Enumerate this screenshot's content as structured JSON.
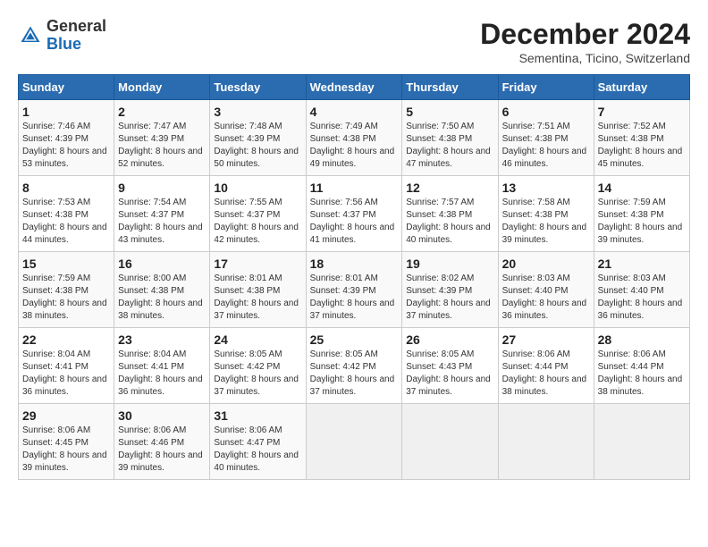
{
  "header": {
    "logo_line1": "General",
    "logo_line2": "Blue",
    "month_title": "December 2024",
    "subtitle": "Sementina, Ticino, Switzerland"
  },
  "weekdays": [
    "Sunday",
    "Monday",
    "Tuesday",
    "Wednesday",
    "Thursday",
    "Friday",
    "Saturday"
  ],
  "weeks": [
    [
      {
        "day": "1",
        "sunrise": "Sunrise: 7:46 AM",
        "sunset": "Sunset: 4:39 PM",
        "daylight": "Daylight: 8 hours and 53 minutes."
      },
      {
        "day": "2",
        "sunrise": "Sunrise: 7:47 AM",
        "sunset": "Sunset: 4:39 PM",
        "daylight": "Daylight: 8 hours and 52 minutes."
      },
      {
        "day": "3",
        "sunrise": "Sunrise: 7:48 AM",
        "sunset": "Sunset: 4:39 PM",
        "daylight": "Daylight: 8 hours and 50 minutes."
      },
      {
        "day": "4",
        "sunrise": "Sunrise: 7:49 AM",
        "sunset": "Sunset: 4:38 PM",
        "daylight": "Daylight: 8 hours and 49 minutes."
      },
      {
        "day": "5",
        "sunrise": "Sunrise: 7:50 AM",
        "sunset": "Sunset: 4:38 PM",
        "daylight": "Daylight: 8 hours and 47 minutes."
      },
      {
        "day": "6",
        "sunrise": "Sunrise: 7:51 AM",
        "sunset": "Sunset: 4:38 PM",
        "daylight": "Daylight: 8 hours and 46 minutes."
      },
      {
        "day": "7",
        "sunrise": "Sunrise: 7:52 AM",
        "sunset": "Sunset: 4:38 PM",
        "daylight": "Daylight: 8 hours and 45 minutes."
      }
    ],
    [
      {
        "day": "8",
        "sunrise": "Sunrise: 7:53 AM",
        "sunset": "Sunset: 4:38 PM",
        "daylight": "Daylight: 8 hours and 44 minutes."
      },
      {
        "day": "9",
        "sunrise": "Sunrise: 7:54 AM",
        "sunset": "Sunset: 4:37 PM",
        "daylight": "Daylight: 8 hours and 43 minutes."
      },
      {
        "day": "10",
        "sunrise": "Sunrise: 7:55 AM",
        "sunset": "Sunset: 4:37 PM",
        "daylight": "Daylight: 8 hours and 42 minutes."
      },
      {
        "day": "11",
        "sunrise": "Sunrise: 7:56 AM",
        "sunset": "Sunset: 4:37 PM",
        "daylight": "Daylight: 8 hours and 41 minutes."
      },
      {
        "day": "12",
        "sunrise": "Sunrise: 7:57 AM",
        "sunset": "Sunset: 4:38 PM",
        "daylight": "Daylight: 8 hours and 40 minutes."
      },
      {
        "day": "13",
        "sunrise": "Sunrise: 7:58 AM",
        "sunset": "Sunset: 4:38 PM",
        "daylight": "Daylight: 8 hours and 39 minutes."
      },
      {
        "day": "14",
        "sunrise": "Sunrise: 7:59 AM",
        "sunset": "Sunset: 4:38 PM",
        "daylight": "Daylight: 8 hours and 39 minutes."
      }
    ],
    [
      {
        "day": "15",
        "sunrise": "Sunrise: 7:59 AM",
        "sunset": "Sunset: 4:38 PM",
        "daylight": "Daylight: 8 hours and 38 minutes."
      },
      {
        "day": "16",
        "sunrise": "Sunrise: 8:00 AM",
        "sunset": "Sunset: 4:38 PM",
        "daylight": "Daylight: 8 hours and 38 minutes."
      },
      {
        "day": "17",
        "sunrise": "Sunrise: 8:01 AM",
        "sunset": "Sunset: 4:38 PM",
        "daylight": "Daylight: 8 hours and 37 minutes."
      },
      {
        "day": "18",
        "sunrise": "Sunrise: 8:01 AM",
        "sunset": "Sunset: 4:39 PM",
        "daylight": "Daylight: 8 hours and 37 minutes."
      },
      {
        "day": "19",
        "sunrise": "Sunrise: 8:02 AM",
        "sunset": "Sunset: 4:39 PM",
        "daylight": "Daylight: 8 hours and 37 minutes."
      },
      {
        "day": "20",
        "sunrise": "Sunrise: 8:03 AM",
        "sunset": "Sunset: 4:40 PM",
        "daylight": "Daylight: 8 hours and 36 minutes."
      },
      {
        "day": "21",
        "sunrise": "Sunrise: 8:03 AM",
        "sunset": "Sunset: 4:40 PM",
        "daylight": "Daylight: 8 hours and 36 minutes."
      }
    ],
    [
      {
        "day": "22",
        "sunrise": "Sunrise: 8:04 AM",
        "sunset": "Sunset: 4:41 PM",
        "daylight": "Daylight: 8 hours and 36 minutes."
      },
      {
        "day": "23",
        "sunrise": "Sunrise: 8:04 AM",
        "sunset": "Sunset: 4:41 PM",
        "daylight": "Daylight: 8 hours and 36 minutes."
      },
      {
        "day": "24",
        "sunrise": "Sunrise: 8:05 AM",
        "sunset": "Sunset: 4:42 PM",
        "daylight": "Daylight: 8 hours and 37 minutes."
      },
      {
        "day": "25",
        "sunrise": "Sunrise: 8:05 AM",
        "sunset": "Sunset: 4:42 PM",
        "daylight": "Daylight: 8 hours and 37 minutes."
      },
      {
        "day": "26",
        "sunrise": "Sunrise: 8:05 AM",
        "sunset": "Sunset: 4:43 PM",
        "daylight": "Daylight: 8 hours and 37 minutes."
      },
      {
        "day": "27",
        "sunrise": "Sunrise: 8:06 AM",
        "sunset": "Sunset: 4:44 PM",
        "daylight": "Daylight: 8 hours and 38 minutes."
      },
      {
        "day": "28",
        "sunrise": "Sunrise: 8:06 AM",
        "sunset": "Sunset: 4:44 PM",
        "daylight": "Daylight: 8 hours and 38 minutes."
      }
    ],
    [
      {
        "day": "29",
        "sunrise": "Sunrise: 8:06 AM",
        "sunset": "Sunset: 4:45 PM",
        "daylight": "Daylight: 8 hours and 39 minutes."
      },
      {
        "day": "30",
        "sunrise": "Sunrise: 8:06 AM",
        "sunset": "Sunset: 4:46 PM",
        "daylight": "Daylight: 8 hours and 39 minutes."
      },
      {
        "day": "31",
        "sunrise": "Sunrise: 8:06 AM",
        "sunset": "Sunset: 4:47 PM",
        "daylight": "Daylight: 8 hours and 40 minutes."
      },
      null,
      null,
      null,
      null
    ]
  ]
}
